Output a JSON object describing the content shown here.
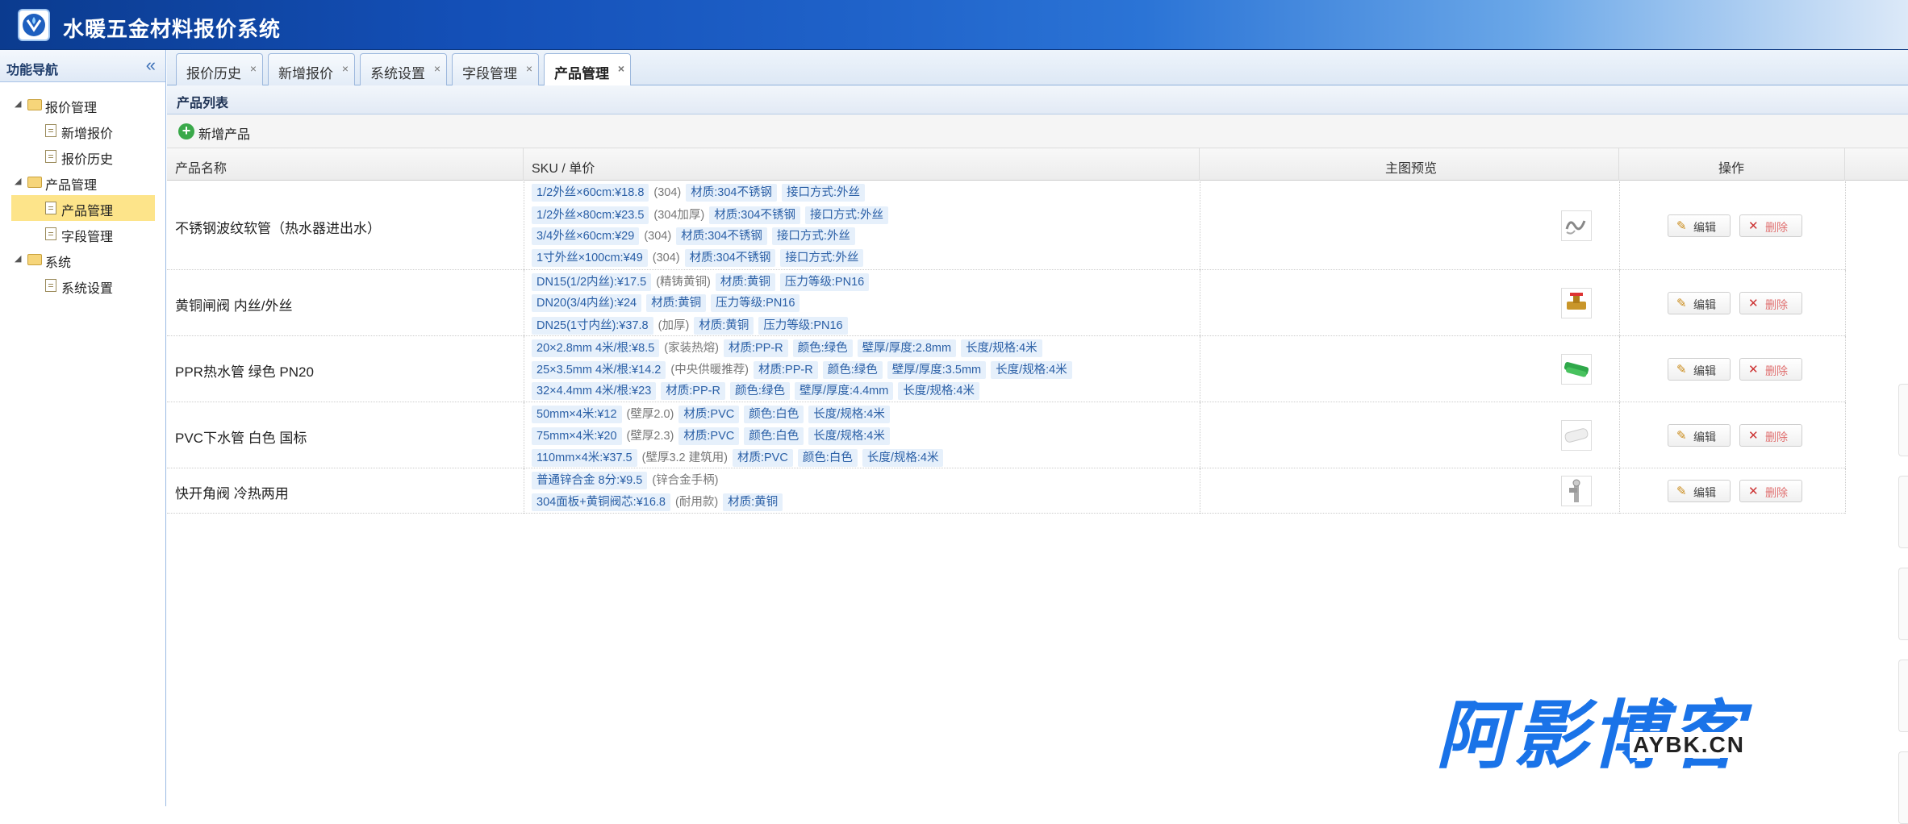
{
  "header": {
    "title": "水暖五金材料报价系统"
  },
  "sidebar": {
    "title": "功能导航",
    "collapse_glyph": "«",
    "groups": [
      {
        "label": "报价管理",
        "children": [
          "新增报价",
          "报价历史"
        ]
      },
      {
        "label": "产品管理",
        "children": [
          "产品管理",
          "字段管理"
        ]
      },
      {
        "label": "系统",
        "children": [
          "系统设置"
        ]
      }
    ],
    "selected": "产品管理"
  },
  "tabs": [
    {
      "label": "报价历史",
      "close": "×"
    },
    {
      "label": "新增报价",
      "close": "×"
    },
    {
      "label": "系统设置",
      "close": "×"
    },
    {
      "label": "字段管理",
      "close": "×"
    },
    {
      "label": "产品管理",
      "close": "×",
      "active": true
    }
  ],
  "panel": {
    "title": "产品列表"
  },
  "toolbar": {
    "add_label": "新增产品"
  },
  "columns": [
    "产品名称",
    "SKU / 单价",
    "主图预览",
    "操作"
  ],
  "actions": {
    "edit": "编辑",
    "delete": "删除"
  },
  "products": [
    {
      "name": "不锈钢波纹软管（热水器进出水）",
      "image": "coiled-hose",
      "skus": [
        {
          "price": "1/2外丝×60cm:¥18.8",
          "note": "(304)",
          "tags": [
            "材质:304不锈钢",
            "接口方式:外丝"
          ]
        },
        {
          "price": "1/2外丝×80cm:¥23.5",
          "note": "(304加厚)",
          "tags": [
            "材质:304不锈钢",
            "接口方式:外丝"
          ]
        },
        {
          "price": "3/4外丝×60cm:¥29",
          "note": "(304)",
          "tags": [
            "材质:304不锈钢",
            "接口方式:外丝"
          ]
        },
        {
          "price": "1寸外丝×100cm:¥49",
          "note": "(304)",
          "tags": [
            "材质:304不锈钢",
            "接口方式:外丝"
          ]
        }
      ]
    },
    {
      "name": "黄铜闸阀 内丝/外丝",
      "image": "brass-valve",
      "skus": [
        {
          "price": "DN15(1/2内丝):¥17.5",
          "note": "(精铸黄铜)",
          "tags": [
            "材质:黄铜",
            "压力等级:PN16"
          ]
        },
        {
          "price": "DN20(3/4内丝):¥24",
          "note": "",
          "tags": [
            "材质:黄铜",
            "压力等级:PN16"
          ]
        },
        {
          "price": "DN25(1寸内丝):¥37.8",
          "note": "(加厚)",
          "tags": [
            "材质:黄铜",
            "压力等级:PN16"
          ]
        }
      ]
    },
    {
      "name": "PPR热水管 绿色 PN20",
      "image": "green-pipe",
      "skus": [
        {
          "price": "20×2.8mm 4米/根:¥8.5",
          "note": "(家装热熔)",
          "tags": [
            "材质:PP-R",
            "颜色:绿色",
            "壁厚/厚度:2.8mm",
            "长度/规格:4米"
          ]
        },
        {
          "price": "25×3.5mm 4米/根:¥14.2",
          "note": "(中央供暖推荐)",
          "tags": [
            "材质:PP-R",
            "颜色:绿色",
            "壁厚/厚度:3.5mm",
            "长度/规格:4米"
          ]
        },
        {
          "price": "32×4.4mm 4米/根:¥23",
          "note": "",
          "tags": [
            "材质:PP-R",
            "颜色:绿色",
            "壁厚/厚度:4.4mm",
            "长度/规格:4米"
          ]
        }
      ]
    },
    {
      "name": "PVC下水管 白色 国标",
      "image": "white-pipe",
      "skus": [
        {
          "price": "50mm×4米:¥12",
          "note": "(壁厚2.0)",
          "tags": [
            "材质:PVC",
            "颜色:白色",
            "长度/规格:4米"
          ]
        },
        {
          "price": "75mm×4米:¥20",
          "note": "(壁厚2.3)",
          "tags": [
            "材质:PVC",
            "颜色:白色",
            "长度/规格:4米"
          ]
        },
        {
          "price": "110mm×4米:¥37.5",
          "note": "(壁厚3.2 建筑用)",
          "tags": [
            "材质:PVC",
            "颜色:白色",
            "长度/规格:4米"
          ]
        }
      ]
    },
    {
      "name": "快开角阀 冷热两用",
      "image": "angle-valve",
      "skus": [
        {
          "price": "普通锌合金 8分:¥9.5",
          "note": "(锌合金手柄)",
          "tags": []
        },
        {
          "price": "304面板+黄铜阀芯:¥16.8",
          "note": "(耐用款)",
          "tags": [
            "材质:黄铜"
          ]
        }
      ]
    }
  ],
  "watermark": {
    "text": "阿影博客",
    "sub": "AYBK.CN"
  }
}
